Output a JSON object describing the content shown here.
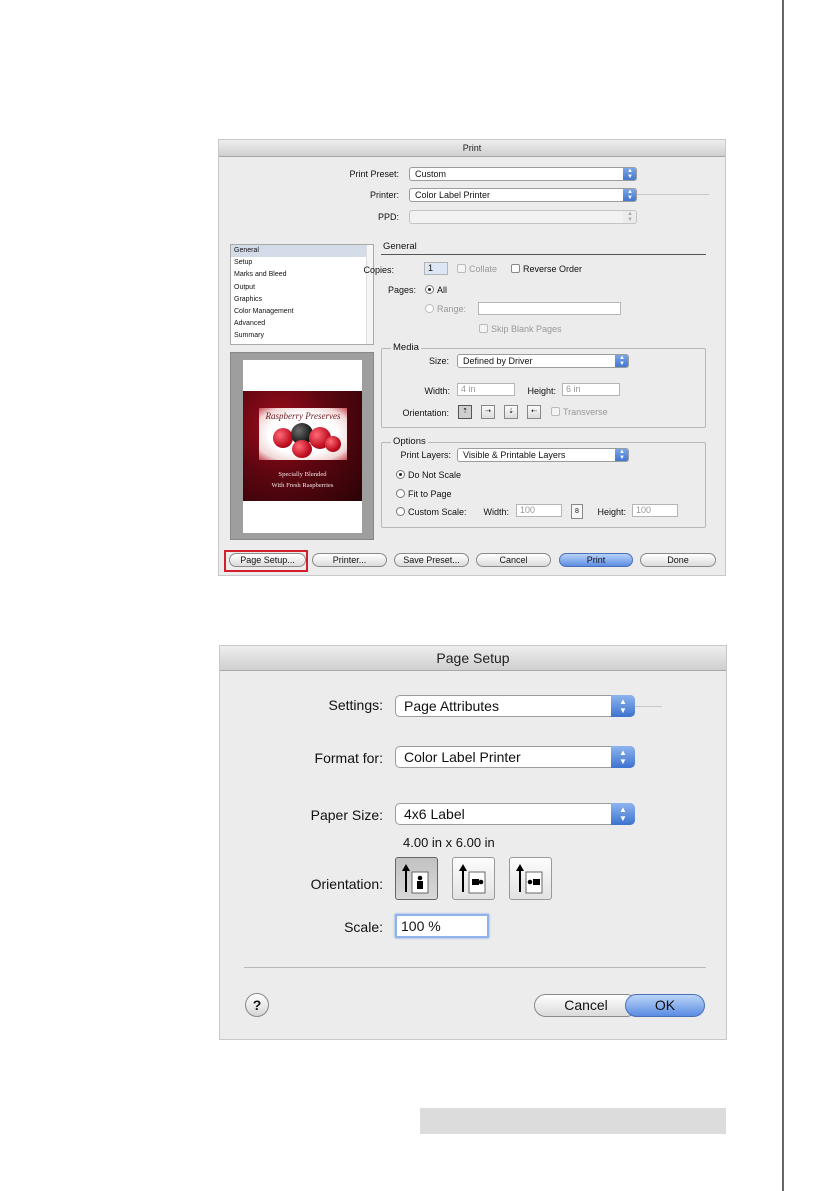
{
  "print_dialog": {
    "title": "Print",
    "print_preset_label": "Print Preset:",
    "print_preset_value": "Custom",
    "printer_label": "Printer:",
    "printer_value": "Color Label Printer",
    "ppd_label": "PPD:",
    "ppd_value": "",
    "sidebar_items": [
      "General",
      "Setup",
      "Marks and Bleed",
      "Output",
      "Graphics",
      "Color Management",
      "Advanced",
      "Summary"
    ],
    "general": {
      "title": "General",
      "copies_label": "Copies:",
      "copies_value": "1",
      "collate_label": "Collate",
      "reverse_order_label": "Reverse Order",
      "pages_label": "Pages:",
      "all_label": "All",
      "range_label": "Range:",
      "skip_blank_label": "Skip Blank Pages"
    },
    "media": {
      "title": "Media",
      "size_label": "Size:",
      "size_value": "Defined by Driver",
      "width_label": "Width:",
      "width_value": "4 in",
      "height_label": "Height:",
      "height_value": "6 in",
      "orientation_label": "Orientation:",
      "transverse_label": "Transverse"
    },
    "options": {
      "title": "Options",
      "print_layers_label": "Print Layers:",
      "print_layers_value": "Visible & Printable Layers",
      "do_not_scale_label": "Do Not Scale",
      "fit_to_page_label": "Fit to Page",
      "custom_scale_label": "Custom Scale:",
      "width_label": "Width:",
      "width_value": "100",
      "height_label": "Height:",
      "height_value": "100"
    },
    "preview": {
      "script_text": "Raspberry Preserves",
      "tagline_1": "Specially Blended",
      "tagline_2": "With Fresh Raspberries"
    },
    "buttons": {
      "page_setup": "Page Setup...",
      "printer": "Printer...",
      "save_preset": "Save Preset...",
      "cancel": "Cancel",
      "print": "Print",
      "done": "Done"
    },
    "colors": {
      "callout": "#d21f2b",
      "default_button": "#5d8ee3"
    }
  },
  "page_setup_dialog": {
    "title": "Page Setup",
    "settings_label": "Settings:",
    "settings_value": "Page Attributes",
    "format_for_label": "Format for:",
    "format_for_value": "Color Label Printer",
    "paper_size_label": "Paper Size:",
    "paper_size_value": "4x6 Label",
    "paper_dimensions": "4.00 in x 6.00 in",
    "orientation_label": "Orientation:",
    "scale_label": "Scale:",
    "scale_value": "100 %",
    "help_label": "?",
    "cancel_label": "Cancel",
    "ok_label": "OK"
  }
}
